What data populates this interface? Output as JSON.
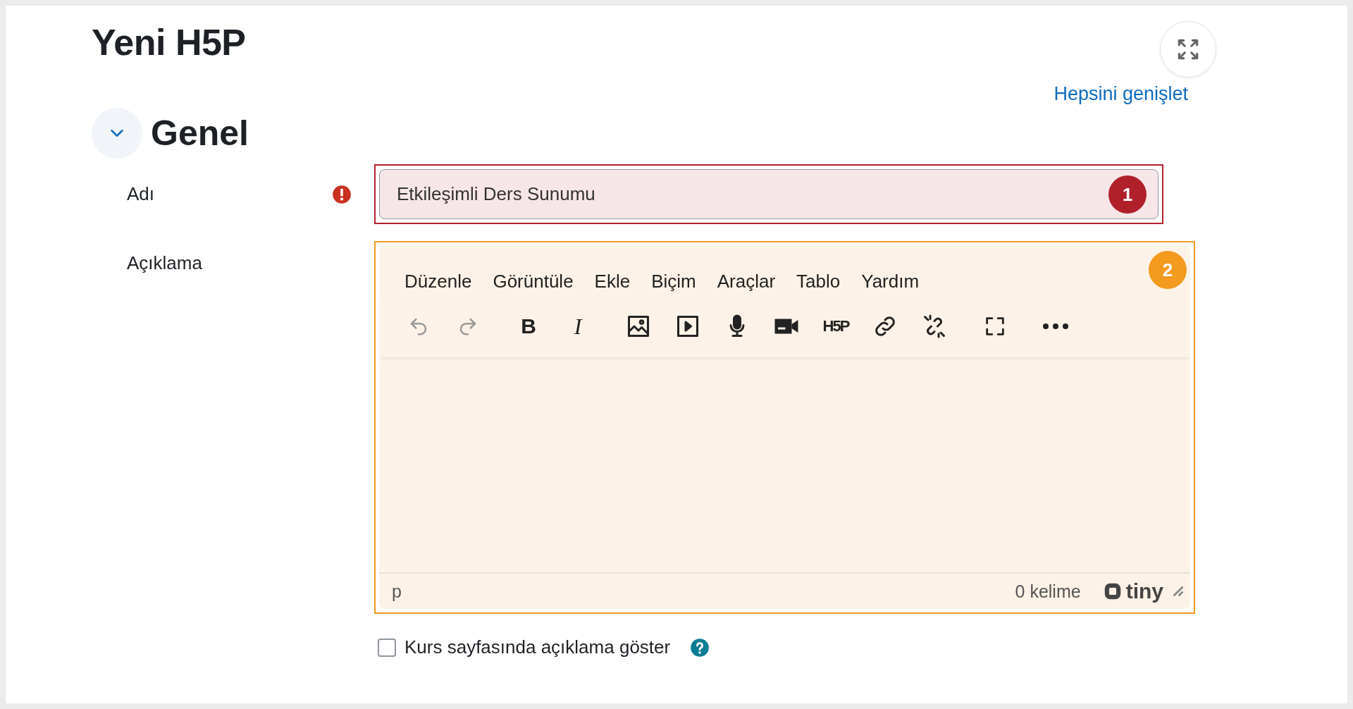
{
  "page": {
    "title": "Yeni H5P",
    "expand_all": "Hepsini genişlet"
  },
  "section": {
    "title": "Genel",
    "expanded": true
  },
  "fields": {
    "name": {
      "label": "Adı",
      "required": true,
      "value": "Etkileşimli Ders Sunumu",
      "invalid": true
    },
    "description": {
      "label": "Açıklama",
      "menu": [
        "Düzenle",
        "Görüntüle",
        "Ekle",
        "Biçim",
        "Araçlar",
        "Tablo",
        "Yardım"
      ],
      "toolbar_groups": [
        [
          {
            "kind": "undo",
            "disabled": true
          },
          {
            "kind": "redo",
            "disabled": true
          }
        ],
        [
          {
            "kind": "bold",
            "label": "B",
            "disabled": false
          },
          {
            "kind": "italic",
            "label": "I",
            "disabled": false
          }
        ],
        [
          {
            "kind": "image",
            "disabled": false
          },
          {
            "kind": "media",
            "disabled": false
          },
          {
            "kind": "audio",
            "disabled": false
          },
          {
            "kind": "video",
            "disabled": false
          },
          {
            "kind": "h5p",
            "label": "H5P",
            "disabled": false
          },
          {
            "kind": "link",
            "disabled": false
          },
          {
            "kind": "unlink",
            "disabled": false
          }
        ],
        [
          {
            "kind": "fullscreen",
            "disabled": false
          }
        ],
        [
          {
            "kind": "more",
            "disabled": false
          }
        ]
      ],
      "path": "p",
      "word_count": "0 kelime",
      "brand": "tiny"
    },
    "show_description": {
      "label": "Kurs sayfasında açıklama göster",
      "checked": false
    }
  },
  "annotations": [
    {
      "number": "1",
      "color": "#b0202b"
    },
    {
      "number": "2",
      "color": "#f39a1f"
    }
  ]
}
